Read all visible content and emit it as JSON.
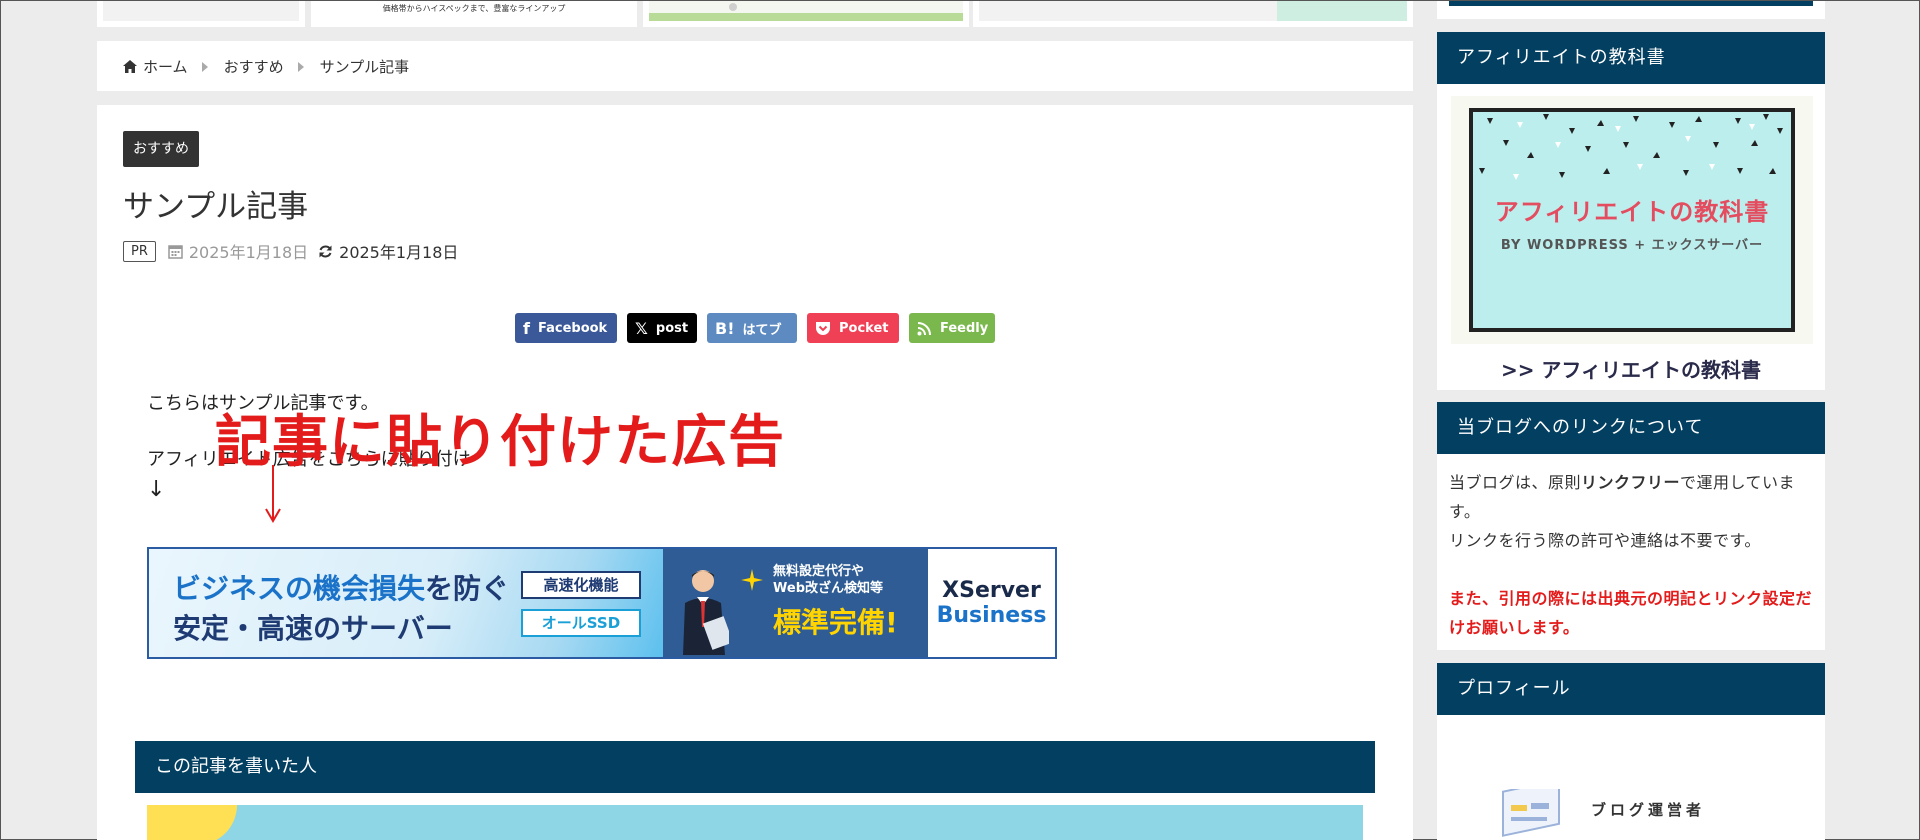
{
  "top_strip": {
    "card2_text": "価格帯からハイスペックまで、豊富なラインアップ"
  },
  "breadcrumb": {
    "items": [
      "ホーム",
      "おすすめ",
      "サンプル記事"
    ]
  },
  "article": {
    "category": "おすすめ",
    "title": "サンプル記事",
    "pr_badge": "PR",
    "published": "2025年1月18日",
    "modified": "2025年1月18日",
    "share": {
      "facebook": "Facebook",
      "x": "post",
      "hatena": "はてブ",
      "pocket": "Pocket",
      "feedly": "Feedly"
    },
    "body_line1": "こちらはサンプル記事です。",
    "body_line2": "アフィリエイト広告をこちらに貼り付け",
    "body_line3": "↓",
    "annotation": "記事に貼り付けた広告",
    "ad": {
      "line1_highlight": "ビジネスの機会損失",
      "line1_rest": "を防ぐ",
      "line2": "安定・高速のサーバー",
      "box1": "高速化機能",
      "box2": "オールSSD",
      "mid_line1": "無料設定代行や",
      "mid_line2": "Web改ざん検知等",
      "mid_big": "標準完備!",
      "brand1": "XServer",
      "brand2": "Business"
    },
    "author_heading": "この記事を書いた人"
  },
  "sidebar": {
    "widget1_title": "アフィリエイトの教科書",
    "book_title": "アフィリエイトの教科書",
    "book_subtitle": "BY WORDPRESS + エックスサーバー",
    "book_link": ">> アフィリエイトの教科書",
    "widget2_title": "当ブログへのリンクについて",
    "link_text_before": "当ブログは、原則",
    "link_text_bold": "リンクフリー",
    "link_text_after": "で運用しています。",
    "link_text2": "リンクを行う際の許可や連絡は不要です。",
    "link_red": "また、引用の際には出典元の明記とリンク設定だけお願いします。",
    "widget3_title": "プロフィール",
    "profile_caption": "ブログ運営者"
  },
  "colors": {
    "navy": "#033f60",
    "annotation_red": "#e31b1b",
    "facebook": "#3b5998",
    "hatena": "#5d8ac1",
    "pocket": "#ef4056",
    "feedly": "#7ab84d"
  }
}
